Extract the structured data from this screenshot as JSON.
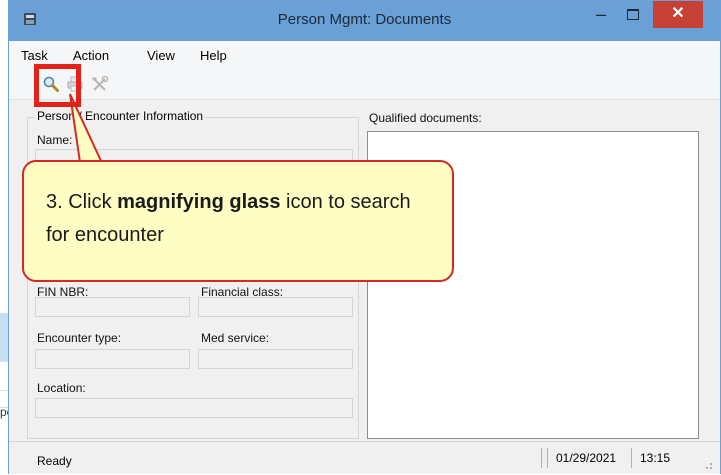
{
  "window": {
    "title": "Person Mgmt: Documents",
    "close_glyph": "✕",
    "minimize_glyph": "–"
  },
  "menu": [
    "Task",
    "Action",
    "View",
    "Help"
  ],
  "toolbar": {
    "icons": [
      "magnifying-glass-icon",
      "printer-icon",
      "tools-icon"
    ]
  },
  "person_group": {
    "label": "Person / Encounter Information",
    "name_label": "Name:",
    "fin_label": "FIN NBR:",
    "financial_class_label": "Financial class:",
    "encounter_type_label": "Encounter type:",
    "med_service_label": "Med service:",
    "location_label": "Location:"
  },
  "qualified_documents": {
    "label": "Qualified documents:"
  },
  "status_bar": {
    "status": "Ready",
    "date": "01/29/2021",
    "time": "13:15"
  },
  "background_dialog": {
    "text": "persons"
  },
  "callout": {
    "step": "3. Click ",
    "bold": "magnifying glass",
    "after": " icon to search for encounter"
  },
  "colors": {
    "titlebar": "#6aa0d6",
    "close_button": "#c74036",
    "callout_fill": "#fdfdc4",
    "callout_border": "#d32a24",
    "highlight": "#e32219"
  }
}
